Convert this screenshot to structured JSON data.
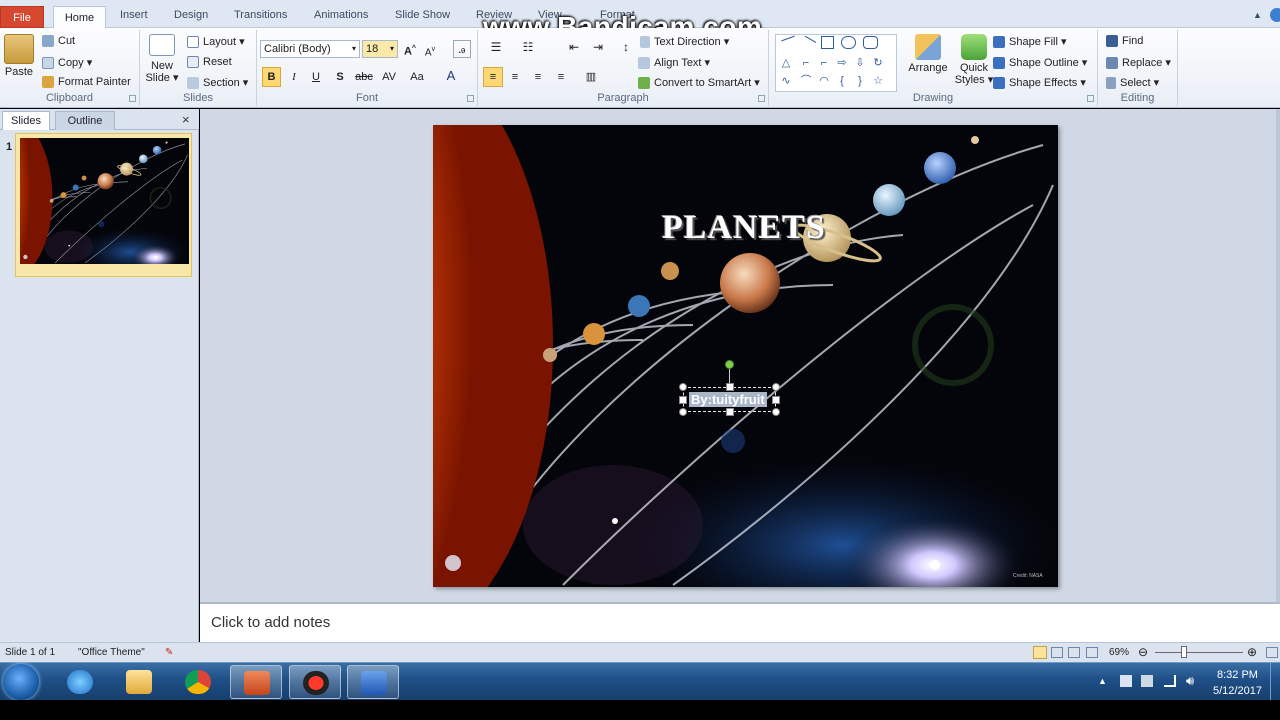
{
  "watermark": "www.Bandicam.com",
  "tabs": {
    "file": "File",
    "items": [
      "Home",
      "Insert",
      "Design",
      "Transitions",
      "Animations",
      "Slide Show",
      "Review",
      "View",
      "Format"
    ]
  },
  "ribbon": {
    "clipboard": {
      "label": "Clipboard",
      "paste": "Paste",
      "cut": "Cut",
      "copy": "Copy",
      "format_painter": "Format Painter"
    },
    "slides": {
      "label": "Slides",
      "new_slide_line1": "New",
      "new_slide_line2": "Slide",
      "layout": "Layout",
      "reset": "Reset",
      "section": "Section"
    },
    "font": {
      "label": "Font",
      "family": "Calibri (Body)",
      "size": "18",
      "bold": "B",
      "italic": "I",
      "underline": "U",
      "shadow": "S",
      "strike": "abc",
      "spacing": "AV",
      "case": "Aa",
      "color": "A"
    },
    "paragraph": {
      "label": "Paragraph",
      "text_direction": "Text Direction",
      "align_text": "Align Text",
      "convert_smartart": "Convert to SmartArt"
    },
    "drawing": {
      "label": "Drawing",
      "arrange": "Arrange",
      "quick_styles_line1": "Quick",
      "quick_styles_line2": "Styles",
      "shape_fill": "Shape Fill",
      "shape_outline": "Shape Outline",
      "shape_effects": "Shape Effects"
    },
    "editing": {
      "label": "Editing",
      "find": "Find",
      "replace": "Replace",
      "select": "Select"
    }
  },
  "left_pane": {
    "tab_slides": "Slides",
    "tab_outline": "Outline",
    "close": "×",
    "thumb_number": "1"
  },
  "slide": {
    "title": "PLANETS",
    "subtitle": "By:tuityfruit",
    "credit": "Credit: NASA"
  },
  "notes": {
    "placeholder": "Click to add notes"
  },
  "status": {
    "slide_of": "Slide 1 of 1",
    "theme": "\"Office Theme\"",
    "zoom": "69%"
  },
  "taskbar": {
    "time": "8:32 PM",
    "date": "5/12/2017"
  },
  "colors": {
    "file_tab": "#d5482f",
    "ribbon_bg": "#f1f5fb",
    "title_text": "#ffffff",
    "selection": "#ffffff"
  }
}
